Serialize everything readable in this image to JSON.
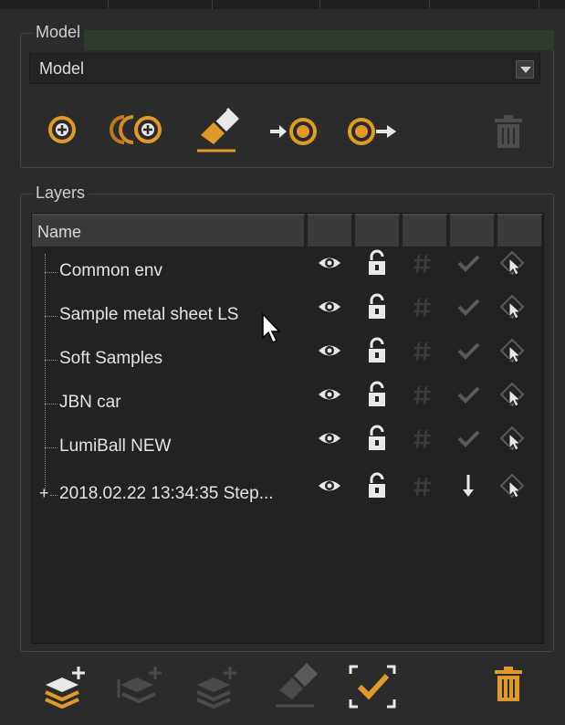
{
  "colors": {
    "accent": "#e09a2b",
    "icon_light": "#e8e8e8",
    "icon_dim": "#5a5a5a",
    "panel_bg": "#2b2b2b",
    "list_bg": "#222222"
  },
  "model_group": {
    "title": "Model",
    "selected_model": "Model",
    "tools": [
      {
        "icon": "add-model-icon",
        "enabled": true
      },
      {
        "icon": "duplicate-model-icon",
        "enabled": true
      },
      {
        "icon": "edit-model-icon",
        "enabled": true
      },
      {
        "icon": "import-model-icon",
        "enabled": true
      },
      {
        "icon": "export-model-icon",
        "enabled": true
      },
      {
        "icon": "trash-icon",
        "enabled": false
      }
    ]
  },
  "layers_group": {
    "title": "Layers",
    "columns": {
      "name": "Name"
    },
    "rows": [
      {
        "name": "Common env",
        "visible": true,
        "locked": false,
        "status": "check-dim",
        "expand": ""
      },
      {
        "name": "Sample metal sheet LS",
        "visible": true,
        "locked": false,
        "status": "check-dim",
        "expand": ""
      },
      {
        "name": "Soft Samples",
        "visible": true,
        "locked": false,
        "status": "check-dim",
        "expand": ""
      },
      {
        "name": "JBN car",
        "visible": true,
        "locked": false,
        "status": "check-dim",
        "expand": ""
      },
      {
        "name": "LumiBall NEW",
        "visible": true,
        "locked": false,
        "status": "check-dim",
        "expand": ""
      },
      {
        "name": "2018.02.22 13:34:35 Step...",
        "visible": true,
        "locked": false,
        "status": "arrow-down",
        "expand": "+"
      }
    ],
    "bottom_tools": [
      {
        "icon": "add-layer-icon",
        "enabled": true
      },
      {
        "icon": "add-sublayer-icon",
        "enabled": false
      },
      {
        "icon": "add-layer-copy-icon",
        "enabled": false
      },
      {
        "icon": "edit-layer-icon",
        "enabled": false
      },
      {
        "icon": "select-check-icon",
        "enabled": true
      },
      {
        "icon": "trash-icon",
        "enabled": true
      }
    ]
  }
}
